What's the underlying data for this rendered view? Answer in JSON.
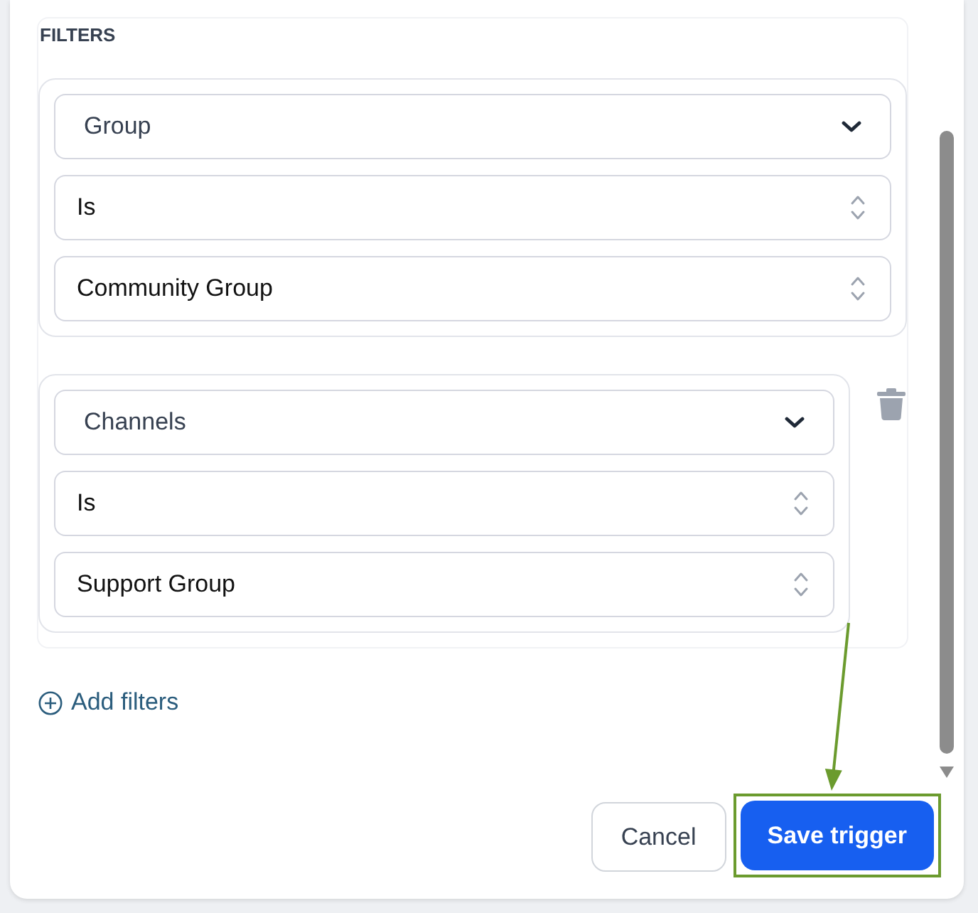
{
  "section": {
    "title": "FILTERS"
  },
  "filters": [
    {
      "field": "Group",
      "operator": "Is",
      "value": "Community Group",
      "removable": false
    },
    {
      "field": "Channels",
      "operator": "Is",
      "value": "Support Group",
      "removable": true
    }
  ],
  "add_filters": {
    "label": "Add filters"
  },
  "buttons": [
    {
      "label": "Cancel",
      "kind": "secondary",
      "highlighted": false
    },
    {
      "label": "Save trigger",
      "kind": "primary",
      "highlighted": true
    }
  ]
}
